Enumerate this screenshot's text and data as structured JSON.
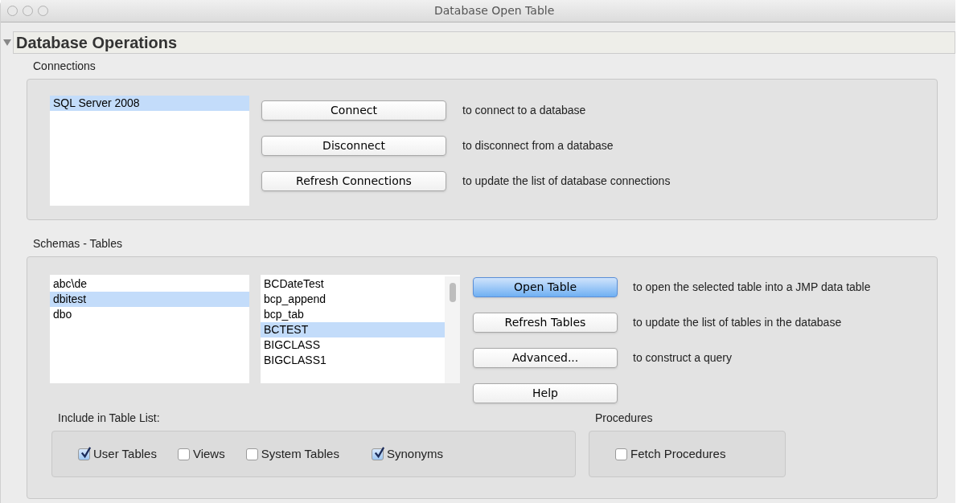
{
  "window": {
    "title": "Database Open Table"
  },
  "section": {
    "title": "Database Operations",
    "expanded": true
  },
  "connections": {
    "label": "Connections",
    "items": [
      {
        "label": "SQL Server 2008",
        "selected": true
      }
    ],
    "actions": [
      {
        "button": "Connect",
        "description": "to connect to a database"
      },
      {
        "button": "Disconnect",
        "description": "to disconnect from a database"
      },
      {
        "button": "Refresh Connections",
        "description": "to update the list of database connections"
      }
    ]
  },
  "schemas_tables": {
    "label": "Schemas - Tables",
    "schemas": [
      {
        "label": "abc\\de",
        "selected": false
      },
      {
        "label": "dbitest",
        "selected": true
      },
      {
        "label": "dbo",
        "selected": false
      }
    ],
    "tables": [
      {
        "label": "BCDateTest",
        "selected": false
      },
      {
        "label": "bcp_append",
        "selected": false
      },
      {
        "label": "bcp_tab",
        "selected": false
      },
      {
        "label": "BCTEST",
        "selected": true
      },
      {
        "label": "BIGCLASS",
        "selected": false
      },
      {
        "label": "BIGCLASS1",
        "selected": false
      }
    ],
    "actions": [
      {
        "button": "Open Table",
        "default": true,
        "description": "to open the selected table into a JMP data table"
      },
      {
        "button": "Refresh Tables",
        "default": false,
        "description": "to update the list of tables in the database"
      },
      {
        "button": "Advanced...",
        "default": false,
        "description": "to construct a query"
      },
      {
        "button": "Help",
        "default": false
      }
    ],
    "include": {
      "label": "Include in Table List:",
      "options": [
        {
          "label": "User Tables",
          "checked": true
        },
        {
          "label": "Views",
          "checked": false
        },
        {
          "label": "System Tables",
          "checked": false
        },
        {
          "label": "Synonyms",
          "checked": true
        }
      ]
    },
    "procedures": {
      "label": "Procedures",
      "options": [
        {
          "label": "Fetch Procedures",
          "checked": false
        }
      ]
    }
  }
}
